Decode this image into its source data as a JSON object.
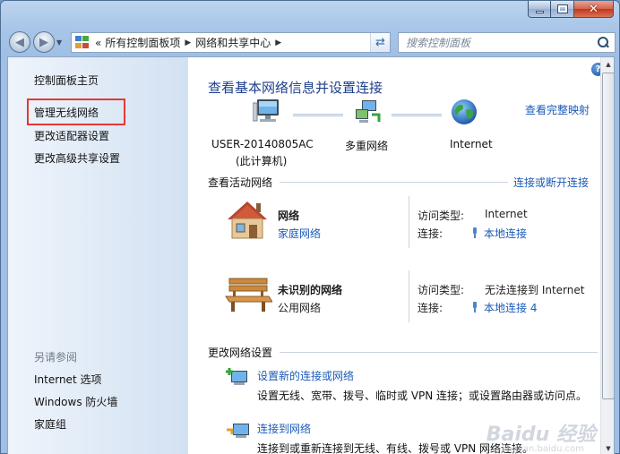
{
  "window": {
    "minimize_glyph": "",
    "maximize_glyph": "",
    "close_glyph": "✕"
  },
  "address_bar": {
    "overflow_chevrons": "«",
    "crumbs": [
      "所有控制面板项",
      "网络和共享中心"
    ],
    "search_placeholder": "搜索控制面板"
  },
  "sidebar": {
    "links": [
      "控制面板主页",
      "管理无线网络",
      "更改适配器设置",
      "更改高级共享设置"
    ],
    "see_also_heading": "另请参阅",
    "see_also": [
      "Internet 选项",
      "Windows 防火墙",
      "家庭组"
    ]
  },
  "main": {
    "title": "查看基本网络信息并设置连接",
    "full_map_link": "查看完整映射",
    "map_nodes": [
      {
        "label": "USER-20140805AC",
        "sublabel": "(此计算机)"
      },
      {
        "label": "多重网络",
        "sublabel": ""
      },
      {
        "label": "Internet",
        "sublabel": ""
      }
    ],
    "active_networks_title": "查看活动网络",
    "connect_disconnect_link": "连接或断开连接",
    "networks": [
      {
        "name": "网络",
        "type": "家庭网络",
        "access_label": "访问类型:",
        "access_value": "Internet",
        "conn_label": "连接:",
        "conn_value": "本地连接"
      },
      {
        "name": "未识别的网络",
        "type": "公用网络",
        "access_label": "访问类型:",
        "access_value": "无法连接到 Internet",
        "conn_label": "连接:",
        "conn_value": "本地连接 4"
      }
    ],
    "change_settings_title": "更改网络设置",
    "tasks": [
      {
        "link": "设置新的连接或网络",
        "desc": "设置无线、宽带、拨号、临时或 VPN 连接；或设置路由器或访问点。"
      },
      {
        "link": "连接到网络",
        "desc": "连接到或重新连接到无线、有线、拨号或 VPN 网络连接。"
      }
    ]
  },
  "watermark": {
    "text": "Baidu 经验",
    "sub": "jingyan.baidu.com"
  }
}
